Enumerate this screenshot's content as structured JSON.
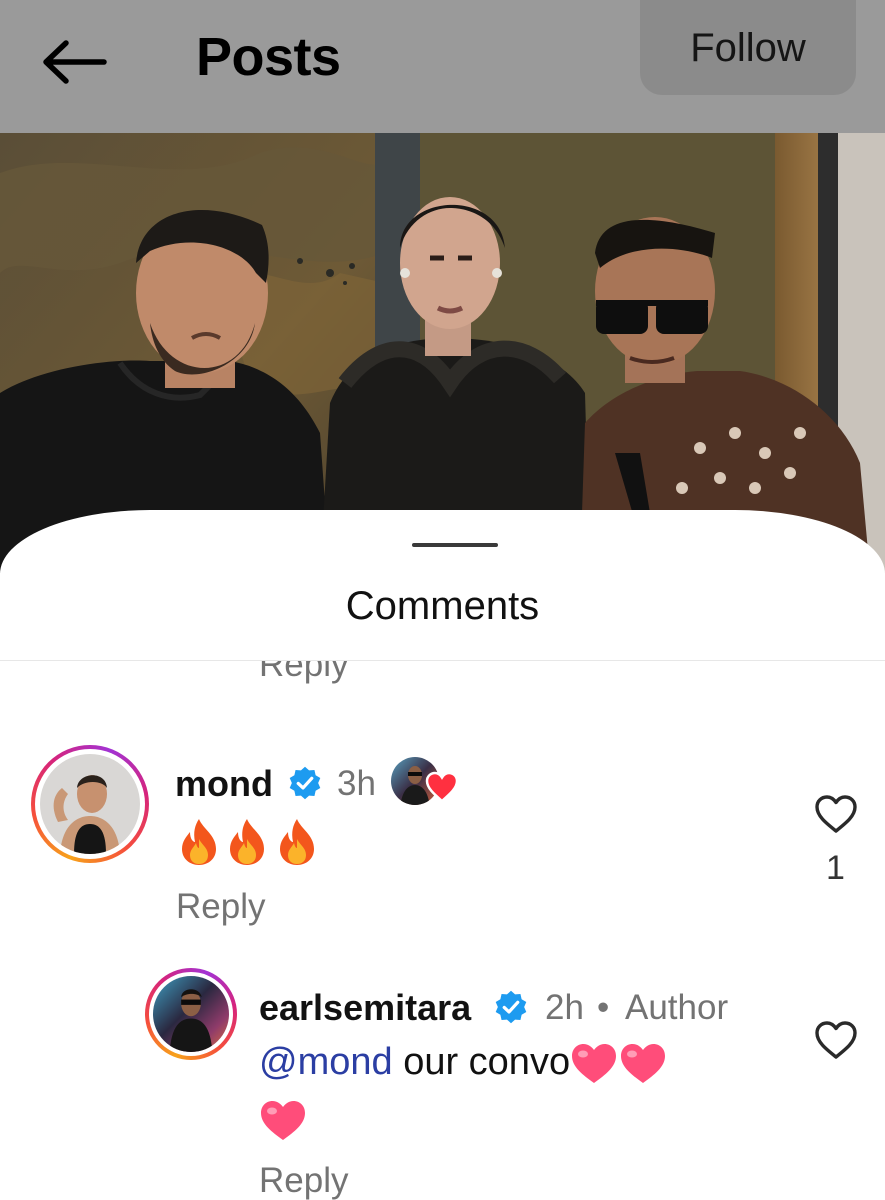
{
  "topbar": {
    "back_icon": "arrow-left-icon",
    "title": "Posts",
    "follow_label": "Follow"
  },
  "photo": {
    "description_icon": "post-photo"
  },
  "sheet": {
    "title": "Comments",
    "clipped_reply_label": "Reply"
  },
  "comments": [
    {
      "username": "mond",
      "verified": true,
      "time": "3h",
      "reactor_icon": "author-liked-heart-icon",
      "text_emoji": [
        "fire-emoji",
        "fire-emoji",
        "fire-emoji"
      ],
      "reply_label": "Reply",
      "like_count": "1",
      "replies": [
        {
          "username": "earlsemitara",
          "verified": true,
          "time": "2h",
          "separator": "•",
          "author_badge": "Author",
          "mention": "@mond",
          "text": " our convo",
          "text_emoji": [
            "pink-heart-emoji",
            "pink-heart-emoji",
            "pink-heart-emoji"
          ],
          "reply_label": "Reply"
        }
      ]
    }
  ],
  "colors": {
    "dim_overlay": "#9a9a9a",
    "meta_gray": "#737373",
    "mention_blue": "#2b3ea3",
    "verified_blue": "#1d9bf0",
    "heart_pink": "#ff4d7a"
  }
}
